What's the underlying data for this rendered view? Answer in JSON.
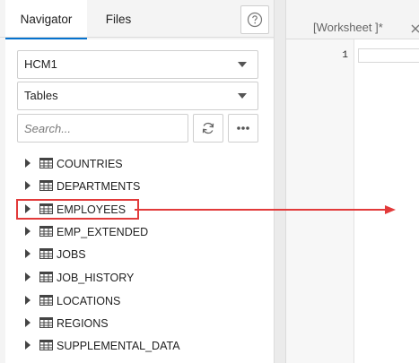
{
  "navigator": {
    "tabs": [
      "Navigator",
      "Files"
    ],
    "active_tab": "Navigator",
    "schema_select": {
      "value": "HCM1"
    },
    "object_type_select": {
      "value": "Tables"
    },
    "search": {
      "placeholder": "Search...",
      "value": ""
    },
    "tree_items": [
      {
        "label": "COUNTRIES"
      },
      {
        "label": "DEPARTMENTS"
      },
      {
        "label": "EMPLOYEES",
        "highlighted": true
      },
      {
        "label": "EMP_EXTENDED"
      },
      {
        "label": "JOBS"
      },
      {
        "label": "JOB_HISTORY"
      },
      {
        "label": "LOCATIONS"
      },
      {
        "label": "REGIONS"
      },
      {
        "label": "SUPPLEMENTAL_DATA"
      }
    ]
  },
  "editor": {
    "tab_label": "[Worksheet ]*",
    "line_numbers": [
      "1"
    ]
  },
  "annotation": {
    "color": "#e23a3a",
    "meaning": "drag table from navigator into worksheet"
  },
  "colors": {
    "accent": "#0572ce",
    "panel_bg": "#f4f4f4",
    "border": "#cfcfcf"
  },
  "icons": {
    "help": "help-icon",
    "refresh": "refresh-icon",
    "more": "more-icon",
    "table": "table-icon",
    "expand": "chevron-right-icon",
    "close": "close-icon"
  }
}
